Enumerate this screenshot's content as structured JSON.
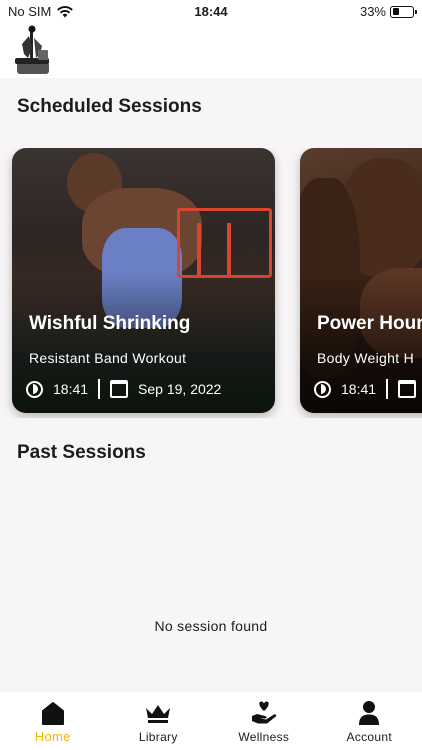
{
  "status_bar": {
    "carrier": "No SIM",
    "time": "18:44",
    "battery_percent": "33%",
    "battery_level": 0.33
  },
  "scheduled": {
    "title": "Scheduled Sessions",
    "cards": [
      {
        "title": "Wishful Shrinking",
        "subtitle": "Resistant Band Workout",
        "time": "18:41",
        "date": "Sep 19, 2022"
      },
      {
        "title": "Power Hour",
        "subtitle": "Body Weight H",
        "time": "18:41",
        "date": ""
      }
    ]
  },
  "past": {
    "title": "Past Sessions",
    "empty_text": "No session found"
  },
  "tabs": [
    {
      "label": "Home",
      "icon": "home-icon",
      "active": true
    },
    {
      "label": "Library",
      "icon": "crown-icon",
      "active": false
    },
    {
      "label": "Wellness",
      "icon": "heart-hand-icon",
      "active": false
    },
    {
      "label": "Account",
      "icon": "person-icon",
      "active": false
    }
  ],
  "colors": {
    "accent": "#f2b705",
    "background": "#f7f5f6"
  }
}
